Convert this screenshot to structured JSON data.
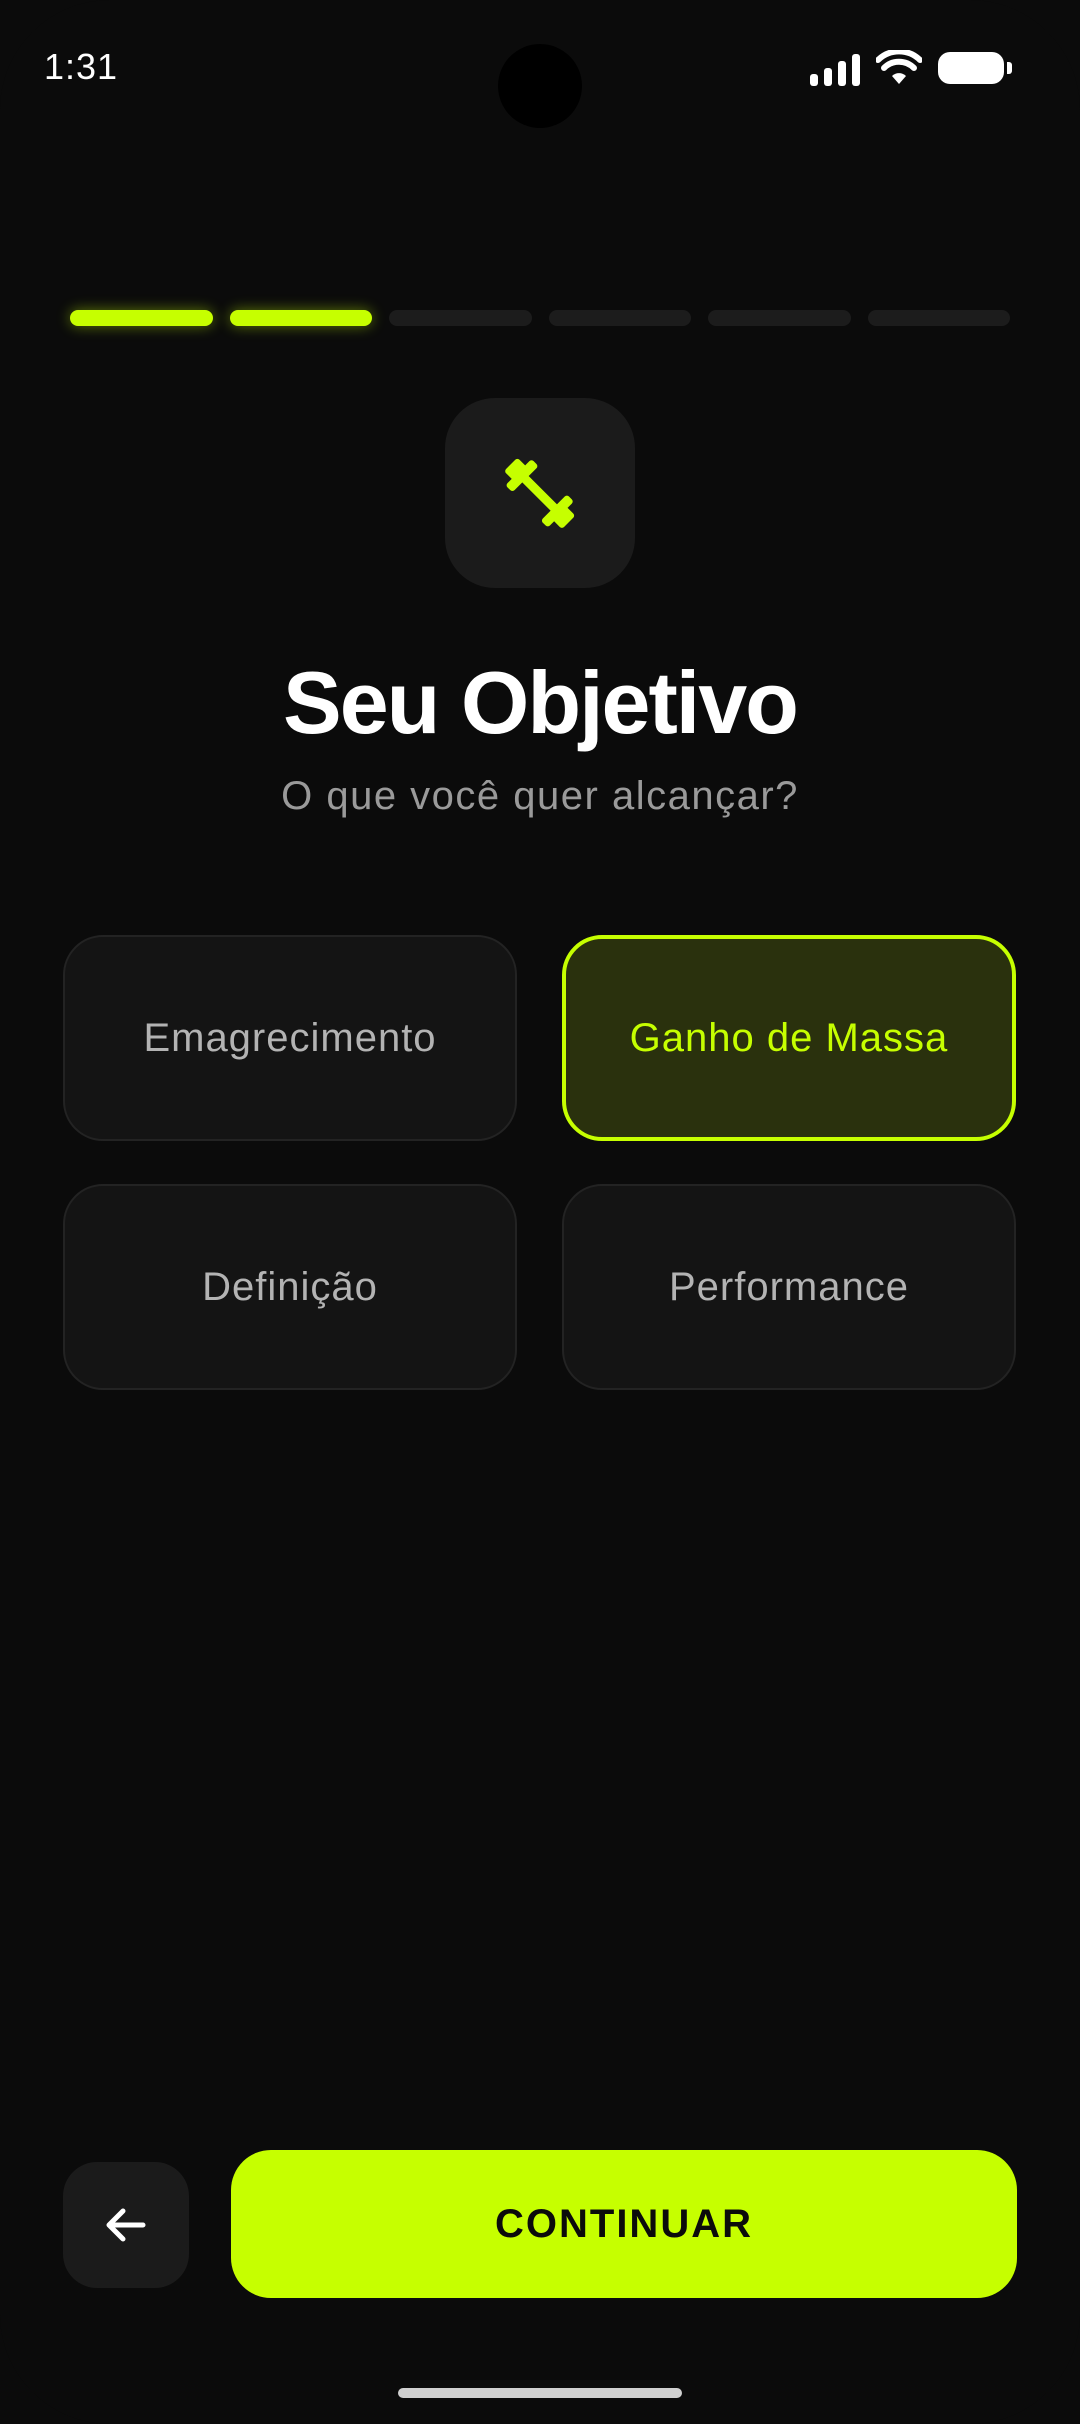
{
  "status_bar": {
    "time": "1:31"
  },
  "progress": {
    "total_steps": 6,
    "completed_steps": 2,
    "accent": "#c6ff00"
  },
  "header": {
    "icon": "dumbbell-icon",
    "title": "Seu Objetivo",
    "subtitle": "O que você quer alcançar?"
  },
  "options": [
    {
      "label": "Emagrecimento",
      "selected": false
    },
    {
      "label": "Ganho de Massa",
      "selected": true
    },
    {
      "label": "Definição",
      "selected": false
    },
    {
      "label": "Performance",
      "selected": false
    }
  ],
  "footer": {
    "back_icon": "arrow-left-icon",
    "continue_label": "CONTINUAR"
  },
  "colors": {
    "background": "#0b0b0b",
    "accent": "#c6ff00",
    "card": "#141414",
    "selected_card": "#2a310d"
  }
}
